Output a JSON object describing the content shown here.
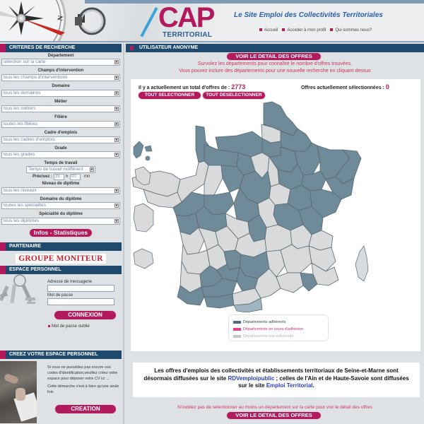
{
  "header": {
    "logo_main": "CAP",
    "logo_sub": "TERRITORIAL",
    "tagline": "Le Site Emploi des Collectivités Territoriales",
    "nav": [
      "Accueil",
      "Acceder à mon profil",
      "Qui sommes nous?"
    ]
  },
  "colors": {
    "brand_magenta": "#b3195d",
    "bar_navy": "#1f4a6e",
    "dept_member": "#6f8b99",
    "dept_pending": "#e0448b",
    "dept_non_member": "#d9dadb",
    "link_blue": "#2b3dc8"
  },
  "left": {
    "search_title": "CRITERES DE RECHERCHE",
    "fields": [
      {
        "label": "Département",
        "value": "sélection sur la carte"
      },
      {
        "label": "Champs d'intervention",
        "value": "tous les champs d'interventions"
      },
      {
        "label": "Domaine",
        "value": "tous les domaines"
      },
      {
        "label": "Métier",
        "value": "tous les métiers"
      },
      {
        "label": "Filière",
        "value": "toutes les filières"
      },
      {
        "label": "Cadre d'emplois",
        "value": "tous les cadres d'emplois"
      },
      {
        "label": "Grade",
        "value": "tous les grades"
      }
    ],
    "work_time": {
      "label": "Temps de travail",
      "value": "Temps de travail indifférent",
      "precise_label": "Précisez :",
      "hours": "35",
      "hours_unit": "h",
      "minutes": "00",
      "minutes_unit": "mn"
    },
    "fields2": [
      {
        "label": "Niveau de diplôme",
        "value": "tous les niveaux"
      },
      {
        "label": "Domaine du diplôme",
        "value": "toutes les spécialités"
      },
      {
        "label": "Spécialité du diplôme",
        "value": "tous les diplômes"
      }
    ],
    "stats_button": "Infos - Statistiques",
    "partner_title": "PARTENAIRE",
    "partner_name": "GROUPE MONITEUR",
    "personal_title": "ESPACE PERSONNEL",
    "email_label": "Adresse de messagerie",
    "email_value": "",
    "password_label": "Mot de passe",
    "password_value": "",
    "login_button": "CONNEXION",
    "forgot_link": "Mot de passe oublié",
    "create_title": "CREEZ VOTRE ESPACE PERSONNEL",
    "create_text1": "Si vous ne possédez pas encore vos codes d'identification,veuillez créez votre espace pour déposer votre CV ici ...",
    "create_text2": "Cette démarche n'est à faire qu'une seule fois",
    "create_button": "CREATION"
  },
  "main": {
    "user_title": "UTILISATEUR ANONYME",
    "view_offers_button": "VOIR LE DETAIL DES OFFRES",
    "hint_line1": "Survolez les départements pour connaître le nombre d'offres trouvées.",
    "hint_line2": "Vous pouvez inclure des départements pour une nouvelle recherche en cliquant dessus",
    "total_label": "Il y a actuellement un total d'offres de :",
    "total_value": "2773",
    "selected_label": "Offres actuellement sélectionnées :",
    "selected_value": "0",
    "select_all": "TOUT SELECTIONNER",
    "deselect_all": "TOUT DESELECTIONNER",
    "legend": [
      {
        "label": "Départements adhérents",
        "color": "#4f6b7b",
        "text_color": "#2d4a5e"
      },
      {
        "label": "Départements en cours d'adhésion",
        "color": "#e0448b",
        "text_color": "#c8327a"
      },
      {
        "label": "Départements non adhérents",
        "color": "#c4c6c8",
        "text_color": "#b0b4b8"
      }
    ],
    "notice_part1": "Les offres d'emplois des collectivités et établissements territoriaux de Seine-et-Marne sont désormais diffusées sur le site ",
    "notice_link1": "RDVemploipublic",
    "notice_part2": " ; celles de l'Ain et de Haute-Savoie sont diffusées sur le site ",
    "notice_link2": "Emploi Territorial",
    "notice_part3": ".",
    "bottom_hint": "N'oubliez pas de sélectionner au moins un département sur la carte pour voir le détail des offres",
    "view_offers_button_bottom": "VOIR LE DETAIL DES OFFRES"
  }
}
